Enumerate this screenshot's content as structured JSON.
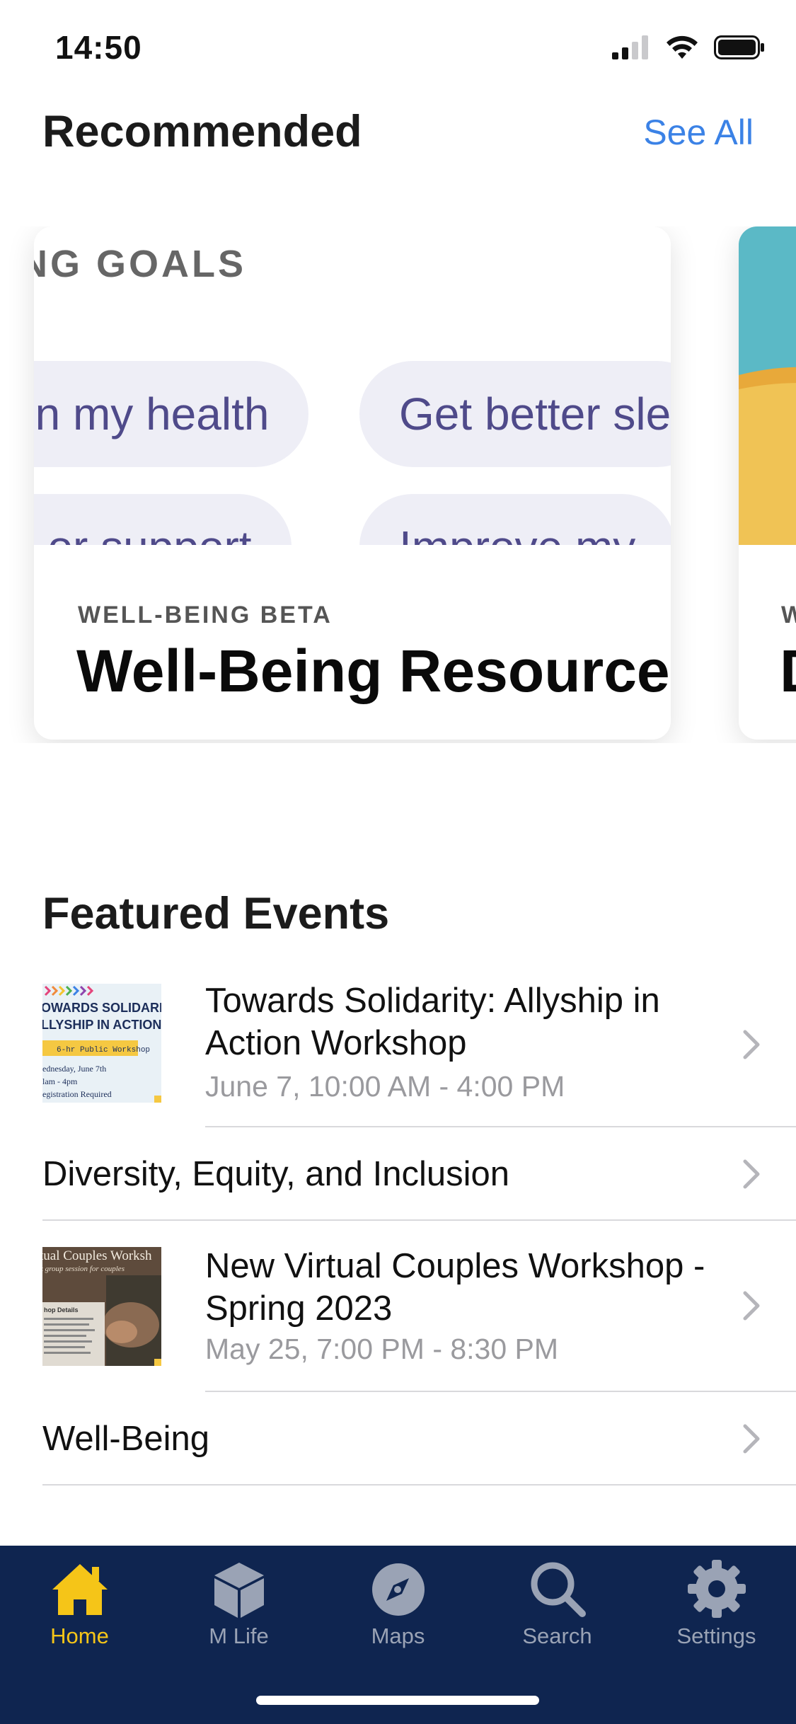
{
  "status": {
    "time": "14:50",
    "icons": [
      "cellular-signal-icon",
      "wifi-icon",
      "battery-icon"
    ]
  },
  "recommended": {
    "title": "Recommended",
    "see_all_label": "See All",
    "cards": [
      {
        "goals_heading": "NG GOALS",
        "pills": [
          "on my health",
          "Get better sle",
          "p or support",
          "Improve my "
        ],
        "eyebrow": "WELL-BEING BETA",
        "title": "Well-Being Resources"
      },
      {
        "eyebrow": "W",
        "title": "D"
      }
    ]
  },
  "featured_events": {
    "title": "Featured Events",
    "items": [
      {
        "title": "Towards Solidarity: Allyship in Action Workshop",
        "subtitle": "June 7, 10:00 AM - 4:00 PM",
        "thumb": {
          "line1": "OWARDS SOLIDARIT",
          "line2": "LLYSHIP IN ACTION",
          "badge": "6-hr Public Workshop",
          "line3": "ednesday, June 7th",
          "line4": "lam - 4pm",
          "line5": "egistration Required"
        }
      },
      {
        "title": "Diversity, Equity, and Inclusion"
      },
      {
        "title": "New Virtual Couples Workshop - Spring 2023",
        "subtitle": "May 25, 7:00 PM - 8:30 PM",
        "thumb": {
          "line1": "tual Couples Worksh",
          "line2": "k group session for couples",
          "line3": "hop Details"
        }
      },
      {
        "title": "Well-Being"
      }
    ]
  },
  "tabbar": {
    "tabs": [
      {
        "label": "Home",
        "icon": "home-icon",
        "active": true
      },
      {
        "label": "M Life",
        "icon": "cube-icon",
        "active": false
      },
      {
        "label": "Maps",
        "icon": "compass-icon",
        "active": false
      },
      {
        "label": "Search",
        "icon": "search-icon",
        "active": false
      },
      {
        "label": "Settings",
        "icon": "gear-icon",
        "active": false
      }
    ]
  },
  "colors": {
    "accent_link": "#3b82e6",
    "tabbar_bg": "#0f2550",
    "tab_active": "#f5c518",
    "tab_inactive": "#9aa3b5"
  }
}
